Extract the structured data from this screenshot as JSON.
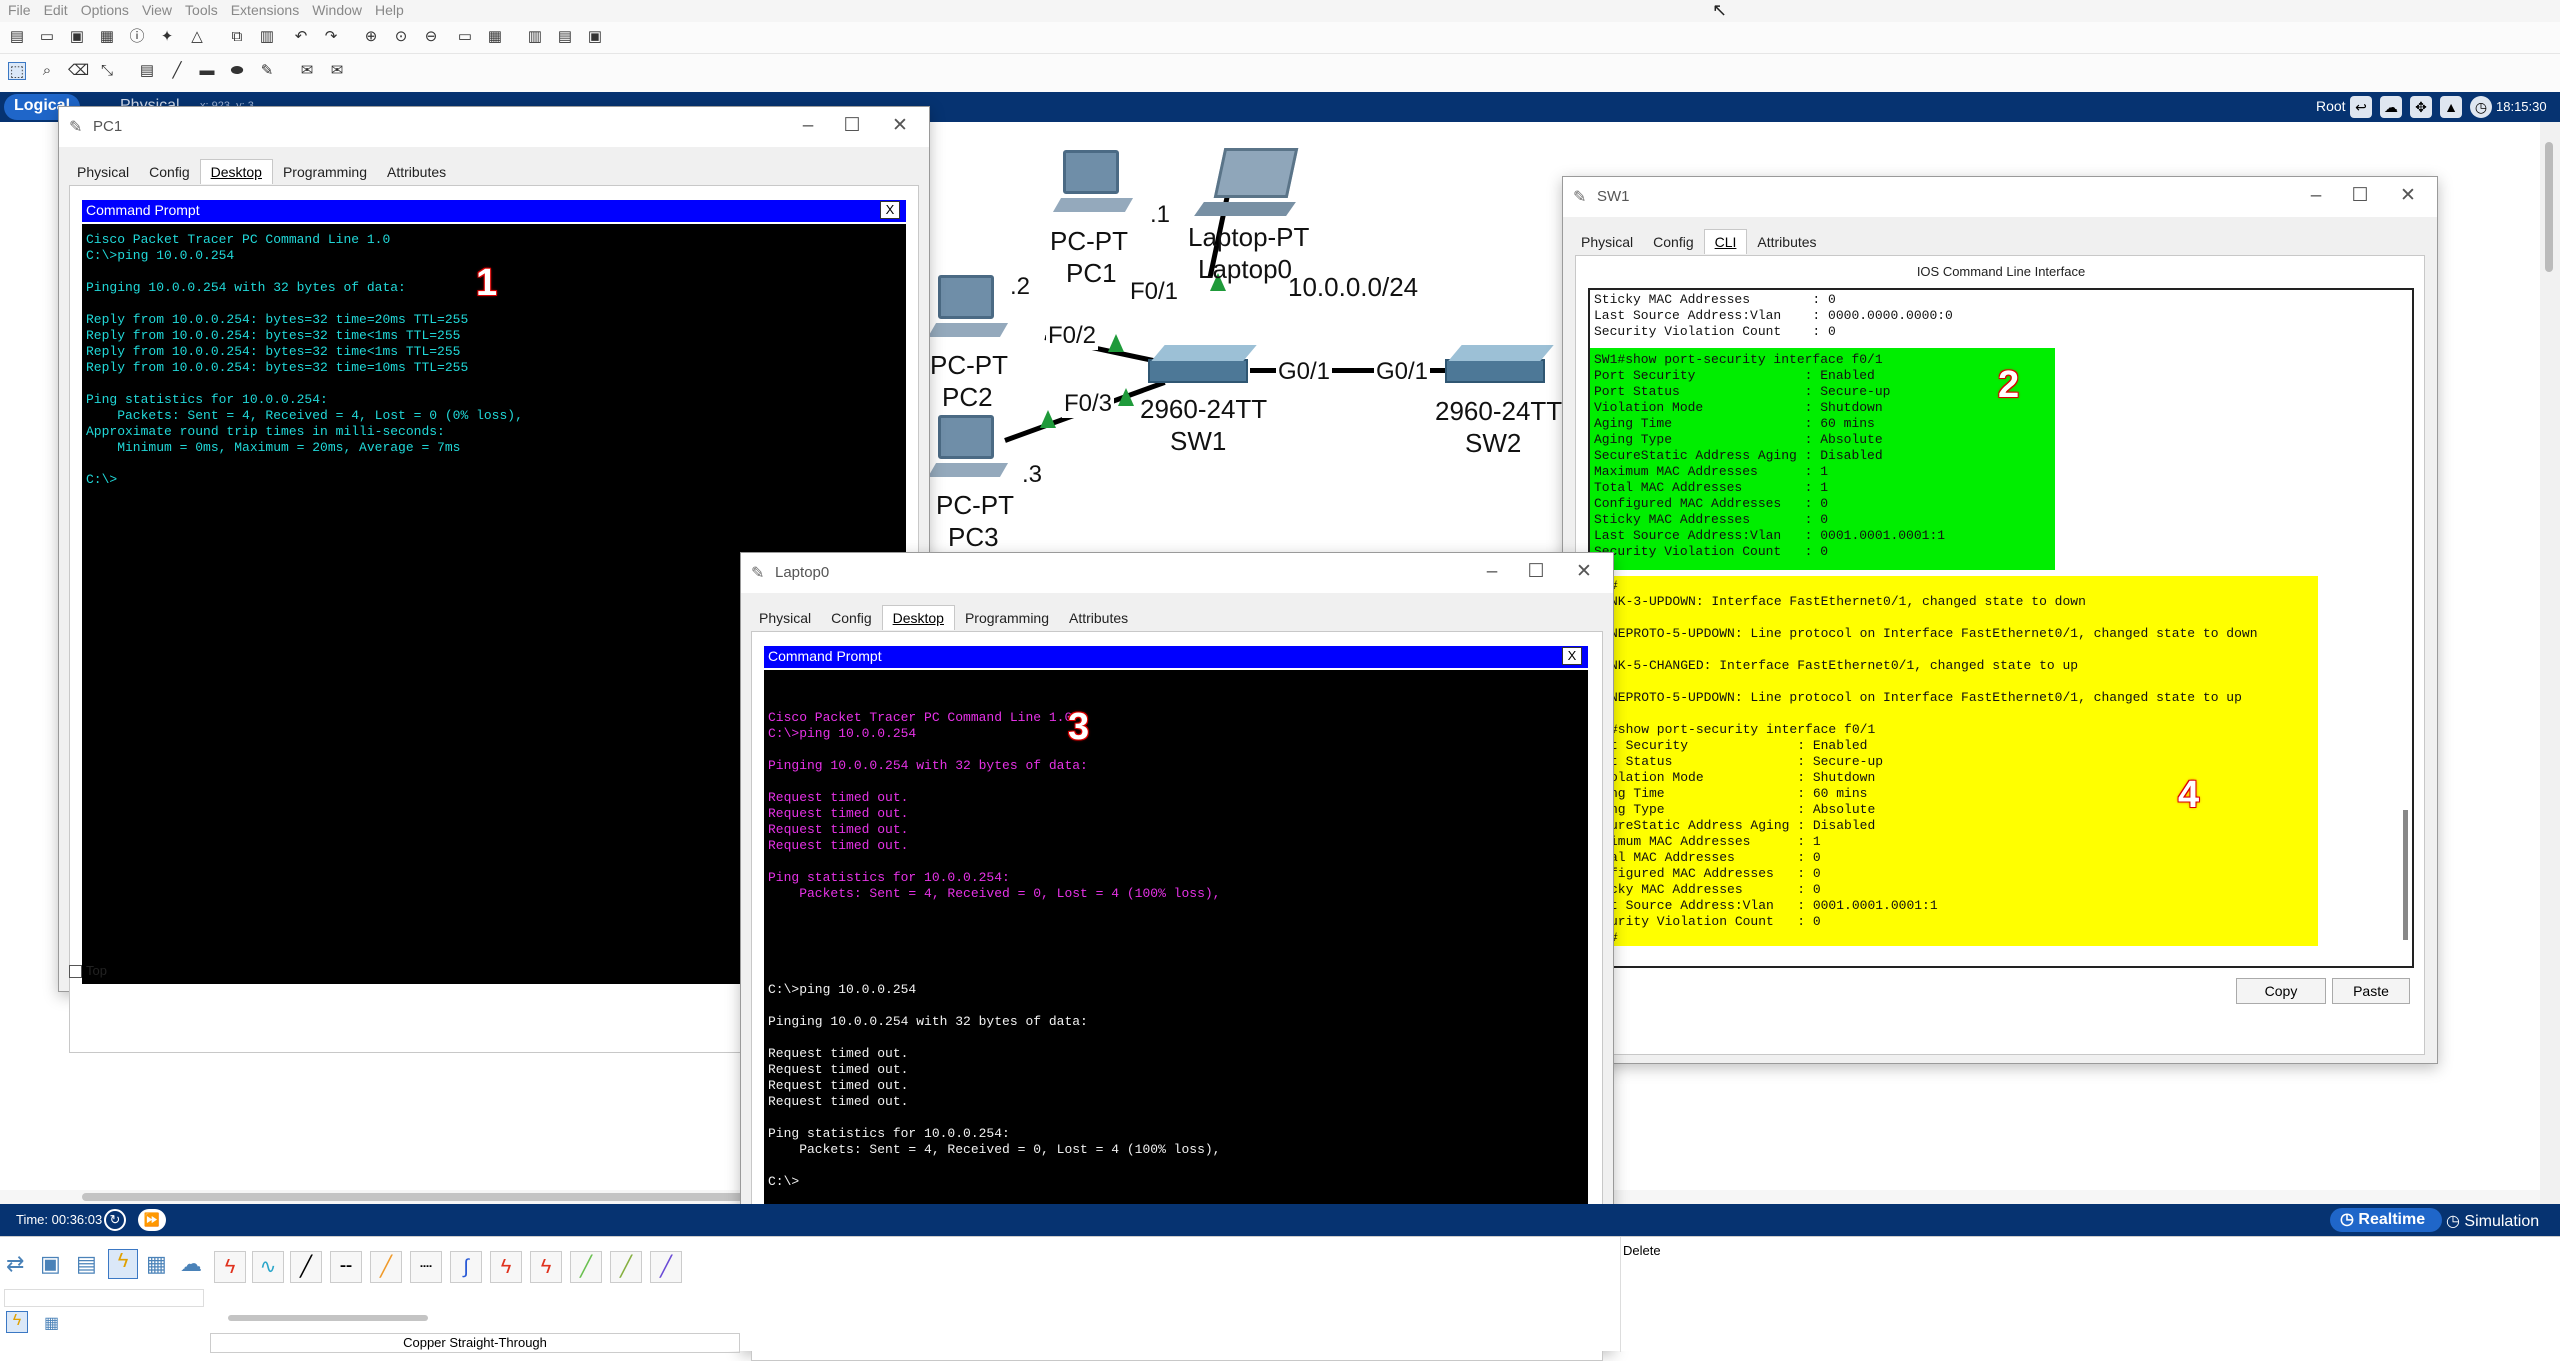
{
  "menubar": {
    "items": [
      "File",
      "Edit",
      "Options",
      "View",
      "Tools",
      "Extensions",
      "Window",
      "Help"
    ],
    "help": "?"
  },
  "modebar": {
    "logical": "Logical",
    "physical": "Physical",
    "coords": "x: 923, y: 3",
    "root": "Root",
    "clock": "18:15:30"
  },
  "topology": {
    "pc1": {
      "type": "PC-PT",
      "name": "PC1",
      "host": ".1"
    },
    "laptop": {
      "type": "Laptop-PT",
      "name": "Laptop0"
    },
    "network": "10.0.0.0/24",
    "pc2": {
      "type": "PC-PT",
      "name": "PC2",
      "host": ".2"
    },
    "pc3": {
      "type": "PC-PT",
      "name": "PC3",
      "host": ".3"
    },
    "sw1": {
      "model": "2960-24TT",
      "name": "SW1"
    },
    "sw2": {
      "model": "2960-24TT",
      "name": "SW2"
    },
    "ports": {
      "f01": "F0/1",
      "f02": "F0/2",
      "f03": "F0/3",
      "g01a": "G0/1",
      "g01b": "G0/1"
    }
  },
  "pc1_window": {
    "title": "PC1",
    "tabs": [
      "Physical",
      "Config",
      "Desktop",
      "Programming",
      "Attributes"
    ],
    "active_tab": "Desktop",
    "cmd_title": "Command Prompt",
    "close": "X",
    "top_checkbox": "Top",
    "console": "Cisco Packet Tracer PC Command Line 1.0\nC:\\>ping 10.0.0.254\n\nPinging 10.0.0.254 with 32 bytes of data:\n\nReply from 10.0.0.254: bytes=32 time=20ms TTL=255\nReply from 10.0.0.254: bytes=32 time<1ms TTL=255\nReply from 10.0.0.254: bytes=32 time<1ms TTL=255\nReply from 10.0.0.254: bytes=32 time=10ms TTL=255\n\nPing statistics for 10.0.0.254:\n    Packets: Sent = 4, Received = 4, Lost = 0 (0% loss),\nApproximate round trip times in milli-seconds:\n    Minimum = 0ms, Maximum = 20ms, Average = 7ms\n\nC:\\>",
    "marker": "1"
  },
  "sw1_window": {
    "title": "SW1",
    "tabs": [
      "Physical",
      "Config",
      "CLI",
      "Attributes"
    ],
    "active_tab": "CLI",
    "header": "IOS Command Line Interface",
    "top_lines": "Sticky MAC Addresses        : 0\nLast Source Address:Vlan    : 0000.0000.0000:0\nSecurity Violation Count    : 0",
    "green_block": "SW1#show port-security interface f0/1\nPort Security              : Enabled\nPort Status                : Secure-up\nViolation Mode             : Shutdown\nAging Time                 : 60 mins\nAging Type                 : Absolute\nSecureStatic Address Aging : Disabled\nMaximum MAC Addresses      : 1\nTotal MAC Addresses        : 1\nConfigured MAC Addresses   : 0\nSticky MAC Addresses       : 0\nLast Source Address:Vlan   : 0001.0001.0001:1\nSecurity Violation Count   : 0",
    "yellow_block": "#\nNK-3-UPDOWN: Interface FastEthernet0/1, changed state to down\n\nNEPROTO-5-UPDOWN: Line protocol on Interface FastEthernet0/1, changed state to down\n\nNK-5-CHANGED: Interface FastEthernet0/1, changed state to up\n\nNEPROTO-5-UPDOWN: Line protocol on Interface FastEthernet0/1, changed state to up\n\n#show port-security interface f0/1\nt Security              : Enabled\nt Status                : Secure-up\nolation Mode            : Shutdown\nng Time                 : 60 mins\nng Type                 : Absolute\nureStatic Address Aging : Disabled\nimum MAC Addresses      : 1\nal MAC Addresses        : 0\nfigured MAC Addresses   : 0\ncky MAC Addresses       : 0\nt Source Address:Vlan   : 0001.0001.0001:1\nurity Violation Count   : 0\n#",
    "copy": "Copy",
    "paste": "Paste",
    "marker_green": "2",
    "marker_yellow": "4"
  },
  "laptop_window": {
    "title": "Laptop0",
    "tabs": [
      "Physical",
      "Config",
      "Desktop",
      "Programming",
      "Attributes"
    ],
    "active_tab": "Desktop",
    "cmd_title": "Command Prompt",
    "close": "X",
    "console_magenta": "Cisco Packet Tracer PC Command Line 1.0\nC:\\>ping 10.0.0.254\n\nPinging 10.0.0.254 with 32 bytes of data:\n\nRequest timed out.\nRequest timed out.\nRequest timed out.\nRequest timed out.\n\nPing statistics for 10.0.0.254:\n    Packets: Sent = 4, Received = 0, Lost = 4 (100% loss),",
    "console_white": "C:\\>ping 10.0.0.254\n\nPinging 10.0.0.254 with 32 bytes of data:\n\nRequest timed out.\nRequest timed out.\nRequest timed out.\nRequest timed out.\n\nPing statistics for 10.0.0.254:\n    Packets: Sent = 4, Received = 0, Lost = 4 (100% loss),\n\nC:\\>",
    "marker": "3"
  },
  "bottombar": {
    "time": "Time: 00:36:03",
    "realtime": "Realtime",
    "simulation": "Simulation"
  },
  "bottom_panel": {
    "cable_label": "Copper Straight-Through",
    "delete": "Delete"
  }
}
